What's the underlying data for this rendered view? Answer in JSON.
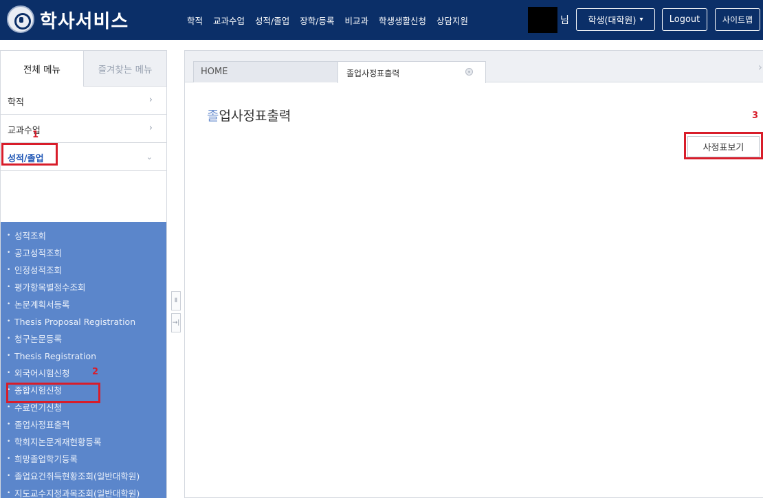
{
  "header": {
    "logo_text": "학사서비스",
    "nav": [
      "학적",
      "교과수업",
      "성적/졸업",
      "장학/등록",
      "비교과",
      "학생생활신청",
      "상담지원"
    ],
    "user_suffix": "님",
    "role": "학생(대학원)",
    "logout_label": "Logout",
    "sitemap_label": "사이트맵"
  },
  "sidebar": {
    "tabs": [
      "전체 메뉴",
      "즐겨찾는 메뉴"
    ],
    "menu": [
      {
        "label": "학적",
        "arrow": "›"
      },
      {
        "label": "교과수업",
        "arrow": "›"
      },
      {
        "label": "성적/졸업",
        "arrow": "⌄"
      }
    ],
    "submenu": [
      "성적조회",
      "공고성적조회",
      "인정성적조회",
      "평가항목별점수조회",
      "논문계획서등록",
      "Thesis Proposal Registration",
      "청구논문등록",
      "Thesis Registration",
      "외국어시험신청",
      "종합시험신청",
      "수료연기신청",
      "졸업사정표출력",
      "학회지논문게재현황등록",
      "희망졸업학기등록",
      "졸업요건취득현황조회(일반대학원)",
      "지도교수지정과목조회(일반대학원)"
    ]
  },
  "content": {
    "tabs": {
      "home": "HOME",
      "active": "졸업사정표출력",
      "next_arrow": "›"
    },
    "title_first": "졸",
    "title_rest": "업사정표출력",
    "view_button": "사정표보기"
  },
  "annotations": {
    "step1": "1",
    "step2": "2",
    "step3": "3",
    "color": "#d81d2a"
  },
  "handles": {
    "pause": "Ⅱ",
    "expand": "→|"
  },
  "colors": {
    "header_bg": "#0b2f68",
    "submenu_bg": "#5b86cb",
    "active_menu": "#1f56b5"
  }
}
